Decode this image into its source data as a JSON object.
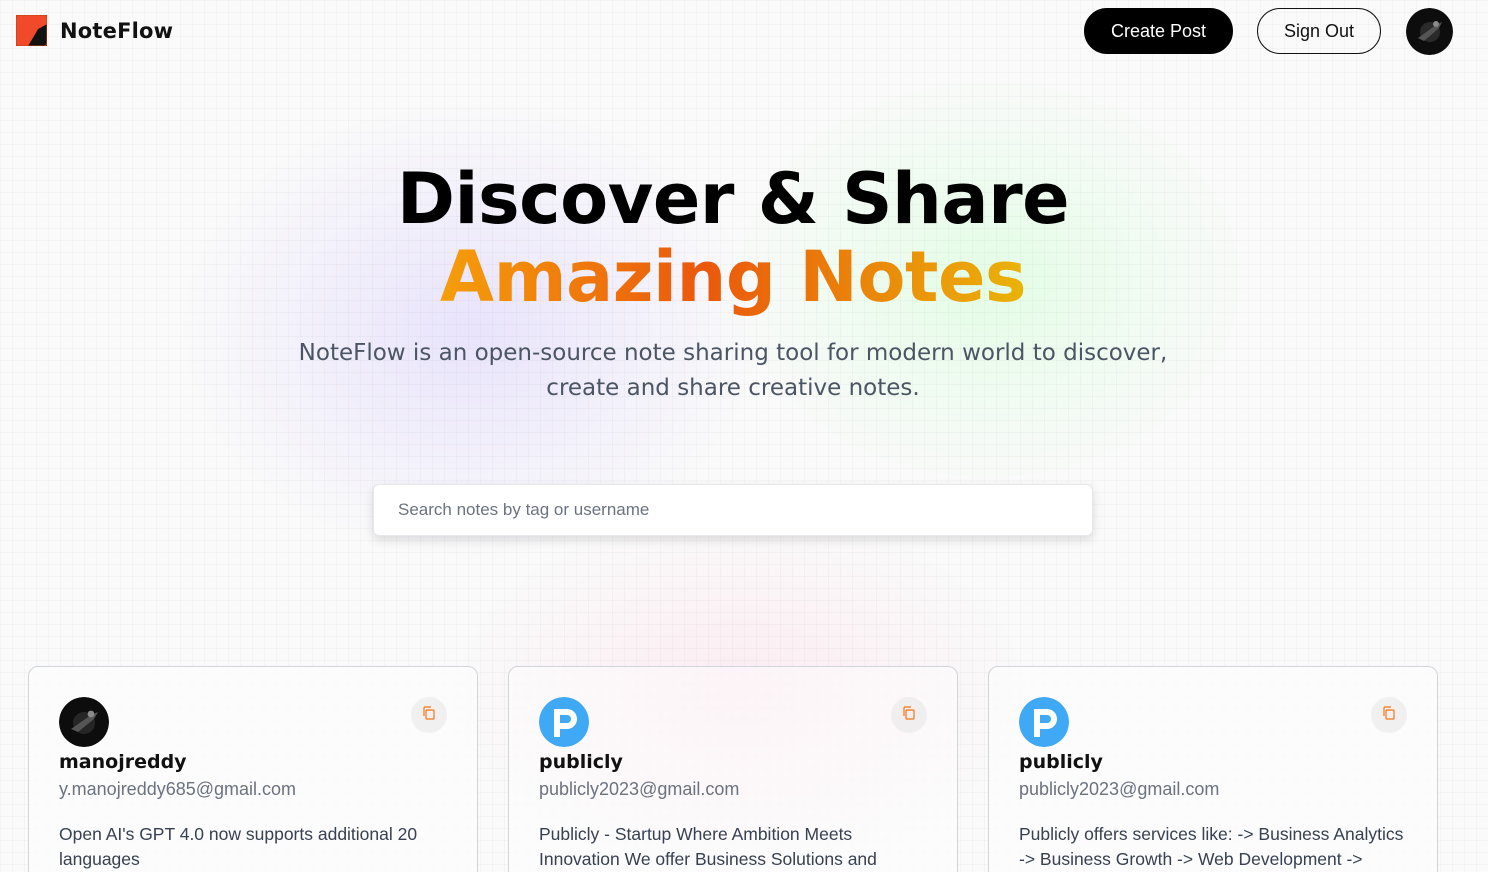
{
  "brand": {
    "name": "NoteFlow",
    "logo_colors": [
      "#ef4444",
      "#f97316",
      "#111111"
    ]
  },
  "nav": {
    "create_label": "Create Post",
    "signout_label": "Sign Out"
  },
  "hero": {
    "title_line1": "Discover & Share",
    "title_line2": "Amazing Notes",
    "description": "NoteFlow is an open-source note sharing tool for modern world to discover, create and share creative notes."
  },
  "search": {
    "placeholder": "Search notes by tag or username",
    "value": ""
  },
  "cards": [
    {
      "username": "manojreddy",
      "email": "y.manojreddy685@gmail.com",
      "text": "Open AI's GPT 4.0 now supports additional 20 languages",
      "avatar": "dark-photo"
    },
    {
      "username": "publicly",
      "email": "publicly2023@gmail.com",
      "text": "Publicly - Startup Where Ambition Meets Innovation We offer Business Solutions and",
      "avatar": "publicly-logo"
    },
    {
      "username": "publicly",
      "email": "publicly2023@gmail.com",
      "text": "Publicly offers services like: -> Business Analytics -> Business Growth -> Web Development ->",
      "avatar": "publicly-logo"
    }
  ],
  "colors": {
    "accent_gradient": [
      "#f59e0b",
      "#ea580c",
      "#eab308"
    ],
    "publicly_blue": "#3fa9f5"
  }
}
